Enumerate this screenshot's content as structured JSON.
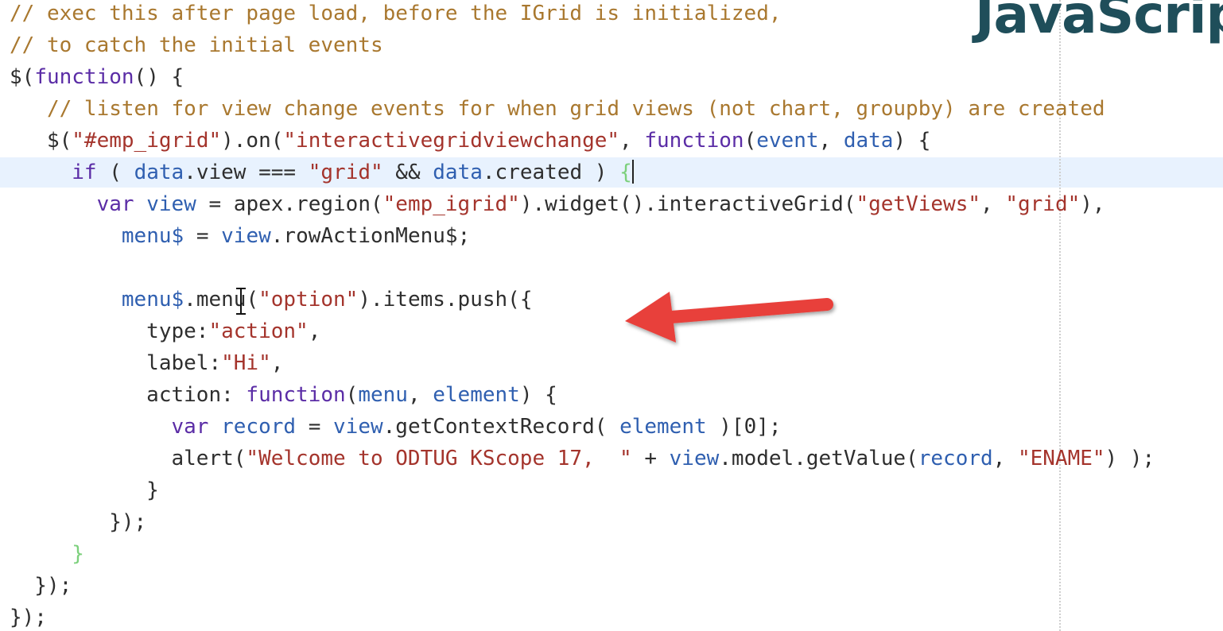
{
  "logo_text": "JavaScrip",
  "colors": {
    "comment": "#a9782f",
    "string": "#a4342c",
    "keyword": "#5b2da6",
    "variable": "#2f5fb0",
    "matched_bracket": "#7cd07c",
    "line_highlight": "#e8f2fe",
    "arrow": "#e8403a"
  },
  "icons": {
    "arrow": "red-arrow-icon",
    "cursor": "text-cursor-icon"
  },
  "code_lines": [
    [
      [
        "comment",
        "// exec this after page load, before the IGrid is initialized,"
      ]
    ],
    [
      [
        "comment",
        "// to catch the initial events"
      ]
    ],
    [
      [
        "plain",
        "$("
      ],
      [
        "keyword",
        "function"
      ],
      [
        "plain",
        "() {"
      ]
    ],
    [
      [
        "plain",
        "   "
      ],
      [
        "comment",
        "// listen for view change events for when grid views (not chart, groupby) are created"
      ]
    ],
    [
      [
        "plain",
        "   $("
      ],
      [
        "string",
        "\"#emp_igrid\""
      ],
      [
        "plain",
        ").on("
      ],
      [
        "string",
        "\"interactivegridviewchange\""
      ],
      [
        "plain",
        ", "
      ],
      [
        "keyword",
        "function"
      ],
      [
        "plain",
        "("
      ],
      [
        "var",
        "event"
      ],
      [
        "plain",
        ", "
      ],
      [
        "var",
        "data"
      ],
      [
        "plain",
        ") {"
      ]
    ],
    [
      [
        "plain",
        "     "
      ],
      [
        "keyword",
        "if"
      ],
      [
        "plain",
        " ( "
      ],
      [
        "var",
        "data"
      ],
      [
        "plain",
        ".view === "
      ],
      [
        "string",
        "\"grid\""
      ],
      [
        "plain",
        " && "
      ],
      [
        "var",
        "data"
      ],
      [
        "plain",
        ".created ) "
      ],
      [
        "bracket",
        "{"
      ]
    ],
    [
      [
        "plain",
        "       "
      ],
      [
        "keyword",
        "var"
      ],
      [
        "plain",
        " "
      ],
      [
        "var",
        "view"
      ],
      [
        "plain",
        " = apex.region("
      ],
      [
        "string",
        "\"emp_igrid\""
      ],
      [
        "plain",
        ").widget().interactiveGrid("
      ],
      [
        "string",
        "\"getViews\""
      ],
      [
        "plain",
        ", "
      ],
      [
        "string",
        "\"grid\""
      ],
      [
        "plain",
        "),"
      ]
    ],
    [
      [
        "plain",
        "         "
      ],
      [
        "var",
        "menu$"
      ],
      [
        "plain",
        " = "
      ],
      [
        "var",
        "view"
      ],
      [
        "plain",
        ".rowActionMenu$;"
      ]
    ],
    [
      [
        "plain",
        ""
      ]
    ],
    [
      [
        "plain",
        "         "
      ],
      [
        "var",
        "menu$"
      ],
      [
        "plain",
        ".menu("
      ],
      [
        "string",
        "\"option\""
      ],
      [
        "plain",
        ").items.push({"
      ]
    ],
    [
      [
        "plain",
        "           type:"
      ],
      [
        "string",
        "\"action\""
      ],
      [
        "plain",
        ","
      ]
    ],
    [
      [
        "plain",
        "           label:"
      ],
      [
        "string",
        "\"Hi\""
      ],
      [
        "plain",
        ","
      ]
    ],
    [
      [
        "plain",
        "           action: "
      ],
      [
        "keyword",
        "function"
      ],
      [
        "plain",
        "("
      ],
      [
        "var",
        "menu"
      ],
      [
        "plain",
        ", "
      ],
      [
        "var",
        "element"
      ],
      [
        "plain",
        ") {"
      ]
    ],
    [
      [
        "plain",
        "             "
      ],
      [
        "keyword",
        "var"
      ],
      [
        "plain",
        " "
      ],
      [
        "var",
        "record"
      ],
      [
        "plain",
        " = "
      ],
      [
        "var",
        "view"
      ],
      [
        "plain",
        ".getContextRecord( "
      ],
      [
        "var",
        "element"
      ],
      [
        "plain",
        " )[0];"
      ]
    ],
    [
      [
        "plain",
        "             alert("
      ],
      [
        "string",
        "\"Welcome to ODTUG KScope 17,  \""
      ],
      [
        "plain",
        " + "
      ],
      [
        "var",
        "view"
      ],
      [
        "plain",
        ".model.getValue("
      ],
      [
        "var",
        "record"
      ],
      [
        "plain",
        ", "
      ],
      [
        "string",
        "\"ENAME\""
      ],
      [
        "plain",
        ") );"
      ]
    ],
    [
      [
        "plain",
        "           }"
      ]
    ],
    [
      [
        "plain",
        "        });"
      ]
    ],
    [
      [
        "plain",
        "     "
      ],
      [
        "bracket",
        "}"
      ]
    ],
    [
      [
        "plain",
        "  });"
      ]
    ],
    [
      [
        "plain",
        "});"
      ]
    ]
  ]
}
